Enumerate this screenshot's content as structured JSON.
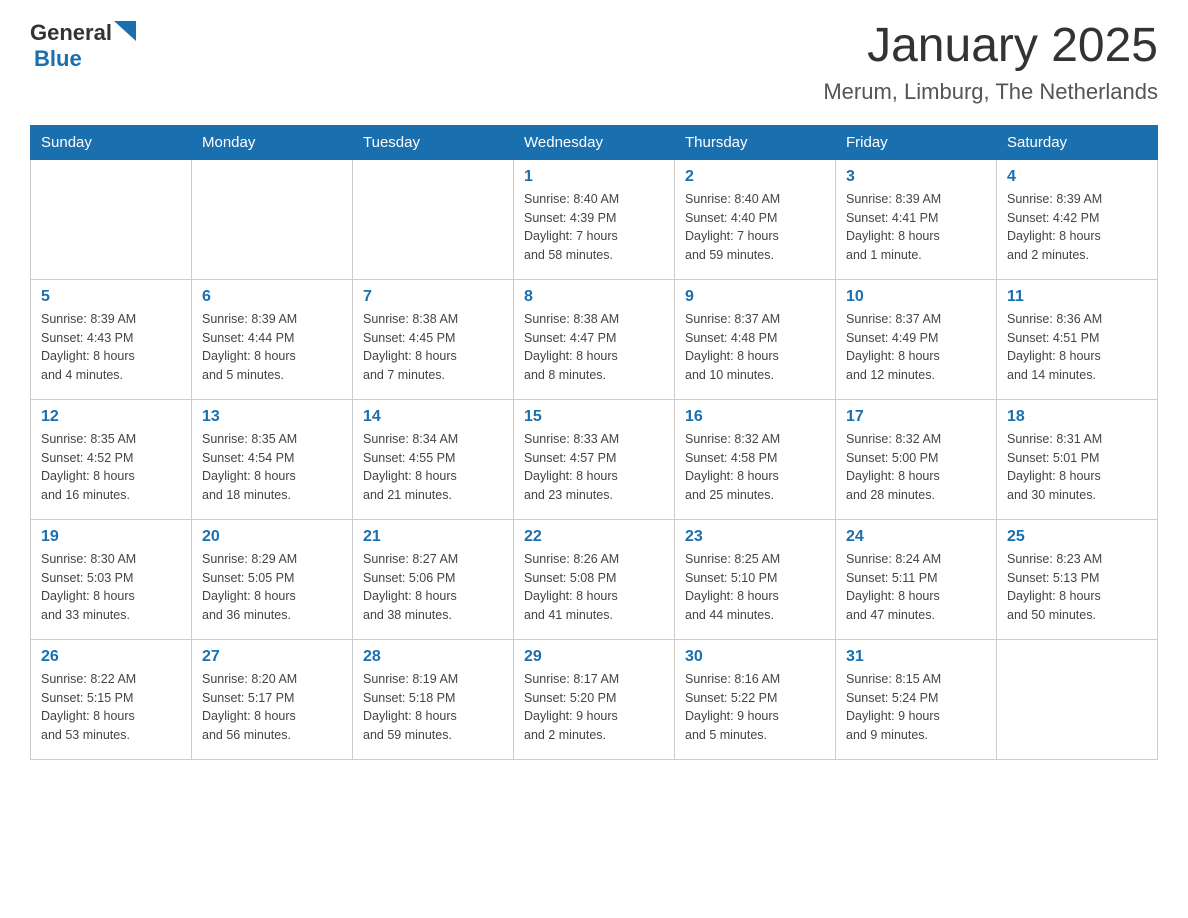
{
  "logo": {
    "general": "General",
    "blue": "Blue"
  },
  "title": {
    "month": "January 2025",
    "location": "Merum, Limburg, The Netherlands"
  },
  "weekdays": [
    "Sunday",
    "Monday",
    "Tuesday",
    "Wednesday",
    "Thursday",
    "Friday",
    "Saturday"
  ],
  "weeks": [
    [
      {
        "day": "",
        "info": ""
      },
      {
        "day": "",
        "info": ""
      },
      {
        "day": "",
        "info": ""
      },
      {
        "day": "1",
        "info": "Sunrise: 8:40 AM\nSunset: 4:39 PM\nDaylight: 7 hours\nand 58 minutes."
      },
      {
        "day": "2",
        "info": "Sunrise: 8:40 AM\nSunset: 4:40 PM\nDaylight: 7 hours\nand 59 minutes."
      },
      {
        "day": "3",
        "info": "Sunrise: 8:39 AM\nSunset: 4:41 PM\nDaylight: 8 hours\nand 1 minute."
      },
      {
        "day": "4",
        "info": "Sunrise: 8:39 AM\nSunset: 4:42 PM\nDaylight: 8 hours\nand 2 minutes."
      }
    ],
    [
      {
        "day": "5",
        "info": "Sunrise: 8:39 AM\nSunset: 4:43 PM\nDaylight: 8 hours\nand 4 minutes."
      },
      {
        "day": "6",
        "info": "Sunrise: 8:39 AM\nSunset: 4:44 PM\nDaylight: 8 hours\nand 5 minutes."
      },
      {
        "day": "7",
        "info": "Sunrise: 8:38 AM\nSunset: 4:45 PM\nDaylight: 8 hours\nand 7 minutes."
      },
      {
        "day": "8",
        "info": "Sunrise: 8:38 AM\nSunset: 4:47 PM\nDaylight: 8 hours\nand 8 minutes."
      },
      {
        "day": "9",
        "info": "Sunrise: 8:37 AM\nSunset: 4:48 PM\nDaylight: 8 hours\nand 10 minutes."
      },
      {
        "day": "10",
        "info": "Sunrise: 8:37 AM\nSunset: 4:49 PM\nDaylight: 8 hours\nand 12 minutes."
      },
      {
        "day": "11",
        "info": "Sunrise: 8:36 AM\nSunset: 4:51 PM\nDaylight: 8 hours\nand 14 minutes."
      }
    ],
    [
      {
        "day": "12",
        "info": "Sunrise: 8:35 AM\nSunset: 4:52 PM\nDaylight: 8 hours\nand 16 minutes."
      },
      {
        "day": "13",
        "info": "Sunrise: 8:35 AM\nSunset: 4:54 PM\nDaylight: 8 hours\nand 18 minutes."
      },
      {
        "day": "14",
        "info": "Sunrise: 8:34 AM\nSunset: 4:55 PM\nDaylight: 8 hours\nand 21 minutes."
      },
      {
        "day": "15",
        "info": "Sunrise: 8:33 AM\nSunset: 4:57 PM\nDaylight: 8 hours\nand 23 minutes."
      },
      {
        "day": "16",
        "info": "Sunrise: 8:32 AM\nSunset: 4:58 PM\nDaylight: 8 hours\nand 25 minutes."
      },
      {
        "day": "17",
        "info": "Sunrise: 8:32 AM\nSunset: 5:00 PM\nDaylight: 8 hours\nand 28 minutes."
      },
      {
        "day": "18",
        "info": "Sunrise: 8:31 AM\nSunset: 5:01 PM\nDaylight: 8 hours\nand 30 minutes."
      }
    ],
    [
      {
        "day": "19",
        "info": "Sunrise: 8:30 AM\nSunset: 5:03 PM\nDaylight: 8 hours\nand 33 minutes."
      },
      {
        "day": "20",
        "info": "Sunrise: 8:29 AM\nSunset: 5:05 PM\nDaylight: 8 hours\nand 36 minutes."
      },
      {
        "day": "21",
        "info": "Sunrise: 8:27 AM\nSunset: 5:06 PM\nDaylight: 8 hours\nand 38 minutes."
      },
      {
        "day": "22",
        "info": "Sunrise: 8:26 AM\nSunset: 5:08 PM\nDaylight: 8 hours\nand 41 minutes."
      },
      {
        "day": "23",
        "info": "Sunrise: 8:25 AM\nSunset: 5:10 PM\nDaylight: 8 hours\nand 44 minutes."
      },
      {
        "day": "24",
        "info": "Sunrise: 8:24 AM\nSunset: 5:11 PM\nDaylight: 8 hours\nand 47 minutes."
      },
      {
        "day": "25",
        "info": "Sunrise: 8:23 AM\nSunset: 5:13 PM\nDaylight: 8 hours\nand 50 minutes."
      }
    ],
    [
      {
        "day": "26",
        "info": "Sunrise: 8:22 AM\nSunset: 5:15 PM\nDaylight: 8 hours\nand 53 minutes."
      },
      {
        "day": "27",
        "info": "Sunrise: 8:20 AM\nSunset: 5:17 PM\nDaylight: 8 hours\nand 56 minutes."
      },
      {
        "day": "28",
        "info": "Sunrise: 8:19 AM\nSunset: 5:18 PM\nDaylight: 8 hours\nand 59 minutes."
      },
      {
        "day": "29",
        "info": "Sunrise: 8:17 AM\nSunset: 5:20 PM\nDaylight: 9 hours\nand 2 minutes."
      },
      {
        "day": "30",
        "info": "Sunrise: 8:16 AM\nSunset: 5:22 PM\nDaylight: 9 hours\nand 5 minutes."
      },
      {
        "day": "31",
        "info": "Sunrise: 8:15 AM\nSunset: 5:24 PM\nDaylight: 9 hours\nand 9 minutes."
      },
      {
        "day": "",
        "info": ""
      }
    ]
  ]
}
